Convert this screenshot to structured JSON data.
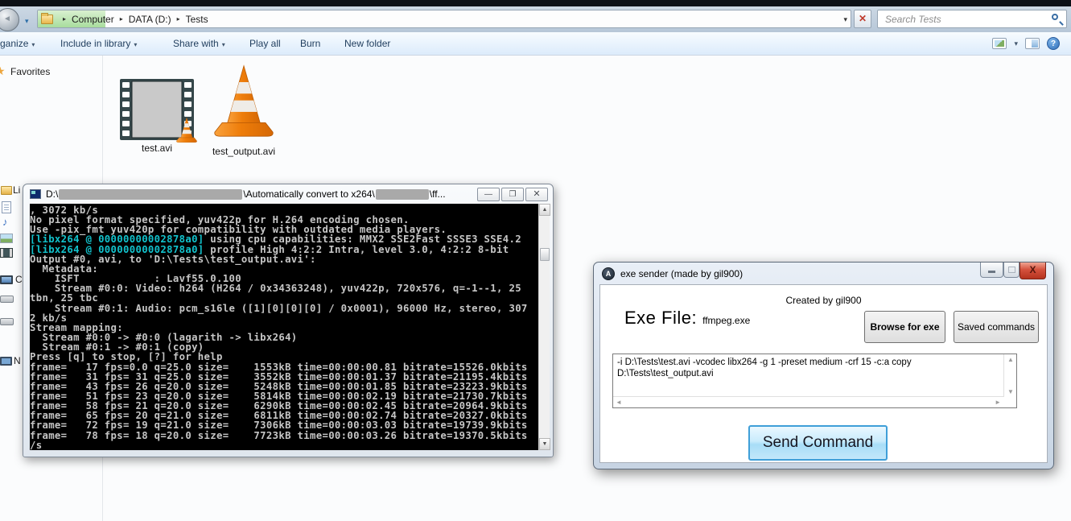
{
  "explorer": {
    "breadcrumb": {
      "items": [
        "Computer",
        "DATA (D:)",
        "Tests"
      ]
    },
    "search": {
      "placeholder": "Search Tests"
    },
    "toolbar": {
      "items": [
        {
          "label": "ganize",
          "caret": true
        },
        {
          "label": "Include in library",
          "caret": true
        },
        {
          "label": "Share with",
          "caret": true
        },
        {
          "label": "Play all",
          "caret": false
        },
        {
          "label": "Burn",
          "caret": false
        },
        {
          "label": "New folder",
          "caret": false
        }
      ],
      "right_icons": [
        "views-icon",
        "views-caret-icon",
        "preview-pane-icon",
        "help-icon"
      ]
    },
    "sidebar": {
      "favorites_label": "Favorites",
      "partial_labels": {
        "libraries": "Li",
        "computer": "C",
        "network": "N"
      }
    },
    "files": [
      {
        "name": "test.avi",
        "icon": "filmstrip-vlc-icon"
      },
      {
        "name": "test_output.avi",
        "icon": "vlc-cone-icon"
      }
    ]
  },
  "console": {
    "title_prefix": "D:\\",
    "title_mid": "\\Automatically convert to x264\\",
    "title_suffix": "\\ff...",
    "buttons": {
      "minimize": "—",
      "restore": "❐",
      "close": "✕"
    },
    "lines": [
      {
        "c": "",
        "t": ", 3072 kb/s"
      },
      {
        "c": "",
        "t": "No pixel format specified, yuv422p for H.264 encoding chosen."
      },
      {
        "c": "",
        "t": "Use -pix_fmt yuv420p for compatibility with outdated media players."
      },
      {
        "c": "[libx264 @ 00000000002878a0]",
        "t": " using cpu capabilities: MMX2 SSE2Fast SSSE3 SSE4.2"
      },
      {
        "c": "[libx264 @ 00000000002878a0]",
        "t": " profile High 4:2:2 Intra, level 3.0, 4:2:2 8-bit"
      },
      {
        "c": "",
        "t": "Output #0, avi, to 'D:\\Tests\\test_output.avi':"
      },
      {
        "c": "",
        "t": "  Metadata:"
      },
      {
        "c": "",
        "t": "    ISFT            : Lavf55.0.100"
      },
      {
        "c": "",
        "t": "    Stream #0:0: Video: h264 (H264 / 0x34363248), yuv422p, 720x576, q=-1--1, 25"
      },
      {
        "c": "",
        "t": "tbn, 25 tbc"
      },
      {
        "c": "",
        "t": "    Stream #0:1: Audio: pcm_s16le ([1][0][0][0] / 0x0001), 96000 Hz, stereo, 307"
      },
      {
        "c": "",
        "t": "2 kb/s"
      },
      {
        "c": "",
        "t": "Stream mapping:"
      },
      {
        "c": "",
        "t": "  Stream #0:0 -> #0:0 (lagarith -> libx264)"
      },
      {
        "c": "",
        "t": "  Stream #0:1 -> #0:1 (copy)"
      },
      {
        "c": "",
        "t": "Press [q] to stop, [?] for help"
      },
      {
        "c": "",
        "t": "frame=   17 fps=0.0 q=25.0 size=    1553kB time=00:00:00.81 bitrate=15526.0kbits"
      },
      {
        "c": "",
        "t": "frame=   31 fps= 31 q=25.0 size=    3552kB time=00:00:01.37 bitrate=21195.4kbits"
      },
      {
        "c": "",
        "t": "frame=   43 fps= 26 q=20.0 size=    5248kB time=00:00:01.85 bitrate=23223.9kbits"
      },
      {
        "c": "",
        "t": "frame=   51 fps= 23 q=20.0 size=    5814kB time=00:00:02.19 bitrate=21730.7kbits"
      },
      {
        "c": "",
        "t": "frame=   58 fps= 21 q=20.0 size=    6290kB time=00:00:02.45 bitrate=20964.9kbits"
      },
      {
        "c": "",
        "t": "frame=   65 fps= 20 q=21.0 size=    6811kB time=00:00:02.74 bitrate=20327.0kbits"
      },
      {
        "c": "",
        "t": "frame=   72 fps= 19 q=21.0 size=    7306kB time=00:00:03.03 bitrate=19739.9kbits"
      },
      {
        "c": "",
        "t": "frame=   78 fps= 18 q=20.0 size=    7723kB time=00:00:03.26 bitrate=19370.5kbits"
      },
      {
        "c": "",
        "t": "/s"
      }
    ],
    "colors": {
      "text": "#c6c6c6",
      "highlight": "#12c3cd",
      "background": "#000000"
    }
  },
  "exe_sender": {
    "title": "exe sender (made by gil900)",
    "created_by": "Created by gil900",
    "exe_file_label": "Exe File:",
    "exe_file_value": "ffmpeg.exe",
    "browse_button": "Browse for exe",
    "saved_button": "Saved commands",
    "command_text": "-i D:\\Tests\\test.avi -vcodec libx264 -g 1 -preset medium -crf 15 -c:a copy D:\\Tests\\test_output.avi",
    "send_button": "Send Command",
    "accent_color": "#3f9fd8"
  }
}
